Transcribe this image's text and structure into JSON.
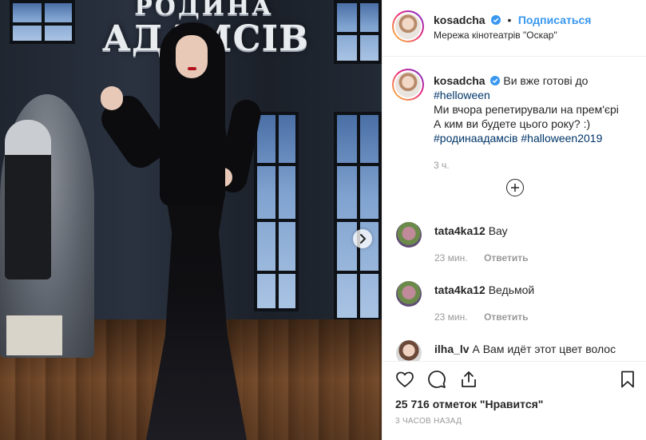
{
  "photo": {
    "logo_line1": "РОДИНА",
    "logo_line2": "АДАМСІВ"
  },
  "header": {
    "username": "kosadcha",
    "separator": "•",
    "follow_label": "Подписаться",
    "location": "Мережа кінотеатрів \"Оскар\""
  },
  "caption": {
    "username": "kosadcha",
    "line1": "Ви вже готові до",
    "tag1": "#helloween",
    "line2": "Ми вчора репетирували на прем'єрі",
    "line3": "А ким ви будете цього року? :)",
    "tag2": "#родинаадамсів",
    "tag3": "#halloween2019",
    "time": "3 ч."
  },
  "comments": [
    {
      "username": "tata4ka12",
      "text": "Вау",
      "time": "23 мин.",
      "reply": "Ответить"
    },
    {
      "username": "tata4ka12",
      "text": "Ведьмой",
      "time": "23 мин.",
      "reply": "Ответить"
    },
    {
      "username": "ilha_lv",
      "text": "А Вам идёт этот цвет волос"
    }
  ],
  "footer": {
    "likes": "25 716 отметок \"Нравится\"",
    "time_ago": "3 ЧАСОВ НАЗАД"
  },
  "colors": {
    "link_blue": "#3897f0",
    "hashtag": "#003569",
    "verified_blue": "#3897f0",
    "muted": "#999999"
  },
  "icons": [
    "chevron-right-icon",
    "verified-badge-icon",
    "plus-circle-icon",
    "heart-icon",
    "comment-icon",
    "share-icon",
    "bookmark-icon"
  ]
}
